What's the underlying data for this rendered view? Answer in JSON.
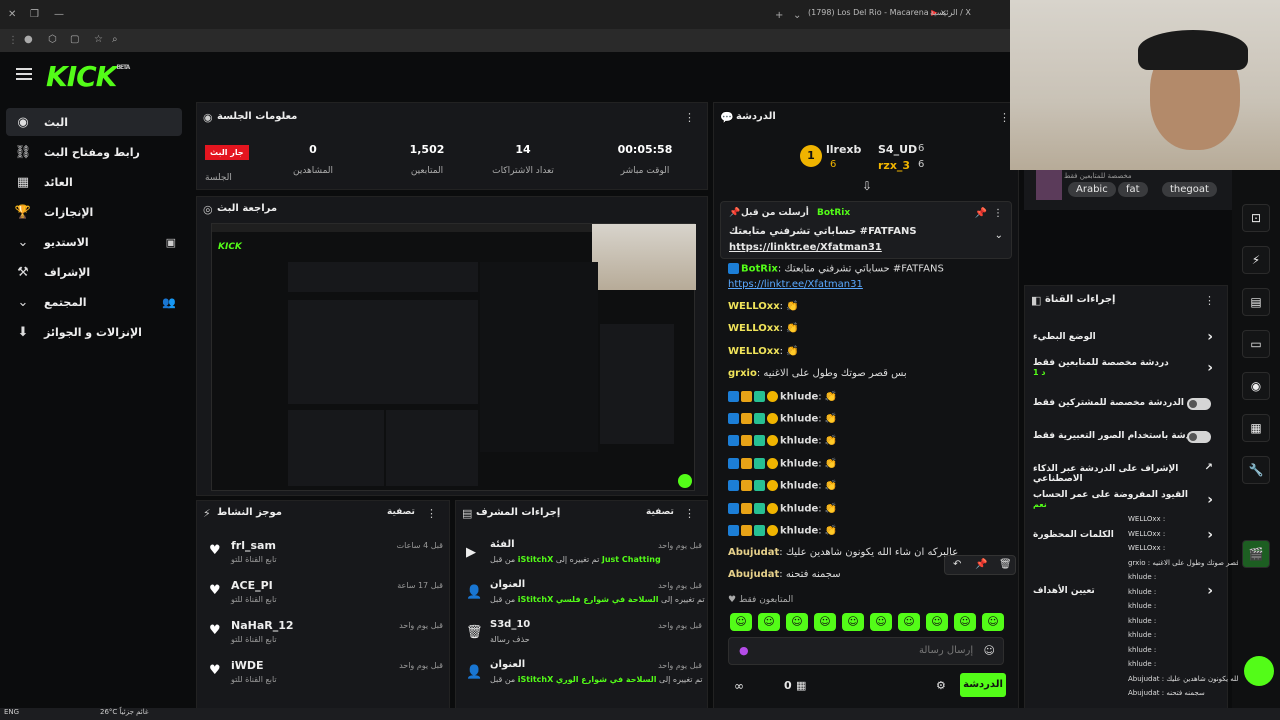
{
  "browser": {
    "tabs": [
      "(1798) Los Del Rio - Macarena",
      "الرئيسية / X"
    ],
    "close_glyph": "×"
  },
  "header": {
    "logo": "KICK",
    "logo_sup": "BETA"
  },
  "sidebar": {
    "items": [
      {
        "label": "البث",
        "icon": "live-icon"
      },
      {
        "label": "رابط ومفتاح البث",
        "icon": "link-icon"
      },
      {
        "label": "العائد",
        "icon": "chart-icon"
      },
      {
        "label": "الإنجازات",
        "icon": "trophy-icon"
      },
      {
        "label": "الاستديو",
        "icon": "studio-icon"
      },
      {
        "label": "الإشراف",
        "icon": "hammer-icon"
      },
      {
        "label": "المجتمع",
        "icon": "community-icon"
      },
      {
        "label": "الإنزالات و الجوائز",
        "icon": "drops-icon"
      }
    ]
  },
  "session": {
    "title": "معلومات الجلسة",
    "live_badge": "جار البث",
    "session_label": "الجلسة",
    "stats": [
      {
        "value": "0",
        "label": "المشاهدين"
      },
      {
        "value": "1,502",
        "label": "المتابعين"
      },
      {
        "value": "14",
        "label": "تعداد الاشتراكات"
      },
      {
        "value": "00:05:58",
        "label": "الوقت مباشر"
      }
    ]
  },
  "preview": {
    "title": "مراجعة البث"
  },
  "activity": {
    "title": "موجز النشاط",
    "filter": "تصفية",
    "rows": [
      {
        "name": "frl_sam",
        "sub": "تابع القناة للتو",
        "time": "قبل 4 ساعات"
      },
      {
        "name": "ACE_PI",
        "sub": "تابع القناة للتو",
        "time": "قبل 17 ساعة"
      },
      {
        "name": "NaHaR_12",
        "sub": "تابع القناة للتو",
        "time": "قبل يوم واحد"
      },
      {
        "name": "iWDE",
        "sub": "تابع القناة للتو",
        "time": "قبل يوم واحد"
      }
    ]
  },
  "modactions": {
    "title": "إجراءات المشرف",
    "filter": "تصفية",
    "rows": [
      {
        "title": "الفئة",
        "desc_pre": "من قبل ",
        "user": "iStitchX",
        "desc_mid": " تم تغييره إلى ",
        "val": "Just Chatting",
        "time": "قبل يوم واحد"
      },
      {
        "title": "العنوان",
        "desc_pre": "من قبل ",
        "user": "iStitchX",
        "desc_mid": " تم تغييره إلى ",
        "val": "السلاحة في شوارع فلسي",
        "time": "قبل يوم واحد"
      },
      {
        "title": "S3d_10",
        "desc_pre": "حذف رسالة",
        "user": "",
        "desc_mid": "",
        "val": "",
        "time": "قبل يوم واحد"
      },
      {
        "title": "العنوان",
        "desc_pre": "من قبل ",
        "user": "iStitchX",
        "desc_mid": " تم تغييره إلى ",
        "val": "السلاحة في شوارع الوري",
        "time": "قبل يوم واحد"
      }
    ]
  },
  "chat": {
    "title": "الدردشة",
    "top_gifters": [
      {
        "name": "llrexb",
        "count": "6",
        "rank": "1"
      },
      {
        "name": "S4_UD",
        "count": "6"
      },
      {
        "name": "rzx_3",
        "count": "6"
      }
    ],
    "pinned": {
      "label": "أرسلت من قبل",
      "user": "BotRix",
      "text": "حساباتي تشرفني متابعتك #FATFANS",
      "link": "https://linktr.ee/Xfatman31"
    },
    "messages": [
      {
        "user": "BotRix",
        "color": "#53fc18",
        "text": "حساباتي تشرفني متابعتك #FATFANS"
      },
      {
        "user": "",
        "color": "#5aa9ff",
        "text": "https://linktr.ee/Xfatman31"
      },
      {
        "user": "WELLOxx",
        "color": "#f0e35a",
        "text": ""
      },
      {
        "user": "WELLOxx",
        "color": "#f0e35a",
        "text": ""
      },
      {
        "user": "WELLOxx",
        "color": "#f0e35a",
        "text": ""
      },
      {
        "user": "grxio",
        "color": "#f0e35a",
        "text": "بس قصر صوتك وطول على الاغنيه"
      },
      {
        "user": "khlude",
        "color": "#ffffff",
        "text": ""
      },
      {
        "user": "khlude",
        "color": "#ffffff",
        "text": ""
      },
      {
        "user": "khlude",
        "color": "#ffffff",
        "text": ""
      },
      {
        "user": "khlude",
        "color": "#ffffff",
        "text": ""
      },
      {
        "user": "khlude",
        "color": "#ffffff",
        "text": ""
      },
      {
        "user": "khlude",
        "color": "#ffffff",
        "text": ""
      },
      {
        "user": "khlude",
        "color": "#ffffff",
        "text": ""
      },
      {
        "user": "Abujudat",
        "color": "#e6d08a",
        "text": "عالبركه ان شاء الله يكونون شاهدين عليك"
      },
      {
        "user": "Abujudat",
        "color": "#e6d08a",
        "text": "سجمنه فتحنه"
      }
    ],
    "followers_only": "المتابعون فقط",
    "input_placeholder": "إرسال رسالة",
    "count": "0",
    "send_label": "الدردشة"
  },
  "channel": {
    "tags": [
      "Arabic",
      "fat",
      "thegoat"
    ],
    "partial_title": "مخصصة للمتابعين فقط"
  },
  "actions_panel": {
    "title": "إجراءات القناة",
    "rows": [
      {
        "label": "الوضع البطيء",
        "type": "chevron",
        "sub": ""
      },
      {
        "label": "دردشة مخصصة للمتابعين فقط",
        "type": "chevron",
        "sub": "د 1"
      },
      {
        "label": "الدردشة مخصصة للمشتركين فقط",
        "type": "toggle",
        "sub": ""
      },
      {
        "label": "الدردشة باستخدام الصور التعبيرية فقط",
        "type": "toggle",
        "sub": ""
      },
      {
        "label": "الإشراف على الدردشة عبر الذكاء الاصطناعي",
        "type": "external",
        "sub": ""
      },
      {
        "label": "القيود المفروضة على عمر الحساب",
        "type": "chevron",
        "sub": "نعم"
      },
      {
        "label": "الكلمات المحظورة",
        "type": "chevron",
        "sub": ""
      },
      {
        "label": "تعيين الأهداف",
        "type": "chevron",
        "sub": ""
      }
    ]
  },
  "mini_chat": [
    "WELLOxx : ",
    "WELLOxx : ",
    "WELLOxx : ",
    "grxio : بس قصر صوتك وطول على الاغنيه",
    "khlude : ",
    "khlude : ",
    "khlude : ",
    "khlude : ",
    "khlude : ",
    "khlude : ",
    "khlude : ",
    "Abujudat : عالبركه ان شاء الله يكونون شاهدين عليك",
    "Abujudat : سجمنه فتحنه"
  ],
  "taskbar": {
    "weather": "26°C غائم جزئياً",
    "lang": "ENG"
  },
  "colors": {
    "brand": "#53fc18",
    "live": "#e4151f",
    "bg": "#0b0c0d",
    "panel": "#17181b"
  }
}
